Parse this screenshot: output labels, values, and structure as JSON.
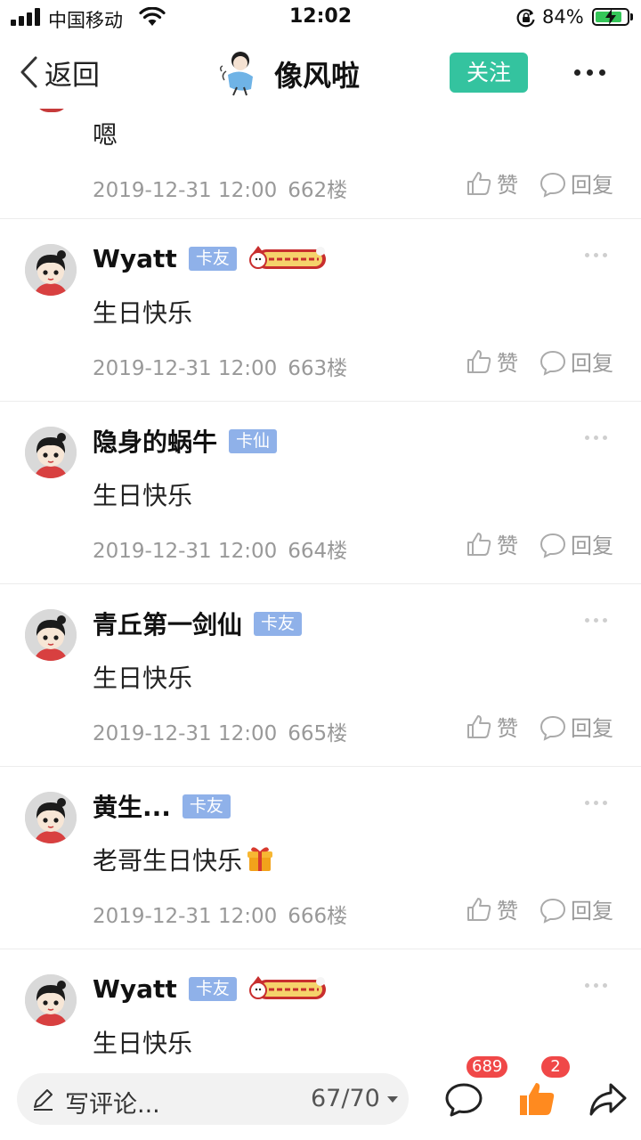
{
  "status_bar": {
    "carrier": "中国移动",
    "time": "12:02",
    "battery_percent": "84%",
    "battery_level": 0.84,
    "battery_color": "#35c759"
  },
  "nav": {
    "back_label": "返回",
    "title": "像风啦",
    "follow_label": "关注",
    "accent_color": "#34c39f"
  },
  "actions": {
    "like_label": "赞",
    "reply_label": "回复"
  },
  "top_comment": {
    "text": "嗯",
    "date": "2019-12-31 12:00",
    "floor": "662楼"
  },
  "comments": [
    {
      "username": "Wyatt",
      "badge": "卡友",
      "christmas_badge": true,
      "text": "生日快乐",
      "date": "2019-12-31 12:00",
      "floor": "663楼"
    },
    {
      "username": "隐身的蜗牛",
      "badge": "卡仙",
      "christmas_badge": false,
      "text": "生日快乐",
      "date": "2019-12-31 12:00",
      "floor": "664楼"
    },
    {
      "username": "青丘第一剑仙",
      "badge": "卡友",
      "christmas_badge": false,
      "text": "生日快乐",
      "date": "2019-12-31 12:00",
      "floor": "665楼"
    },
    {
      "username": "黄生...",
      "badge": "卡友",
      "christmas_badge": false,
      "text": "老哥生日快乐",
      "has_gift_emoji": true,
      "date": "2019-12-31 12:00",
      "floor": "666楼"
    },
    {
      "username": "Wyatt",
      "badge": "卡友",
      "christmas_badge": true,
      "text": "生日快乐"
    }
  ],
  "bottom_bar": {
    "input_placeholder": "写评论...",
    "page_indicator": "67/70",
    "comment_count": "689",
    "like_count": "2",
    "count_color": "#f04848",
    "like_icon_color": "#ff8a1f"
  },
  "icons": [
    "signal-icon",
    "wifi-icon",
    "rotation-lock-icon",
    "battery-icon",
    "back-chevron-icon",
    "more-icon",
    "thumbs-up-icon",
    "reply-bubble-icon",
    "pen-icon",
    "comment-icon",
    "like-icon",
    "share-icon",
    "gift-icon",
    "christmas-badge-icon"
  ]
}
